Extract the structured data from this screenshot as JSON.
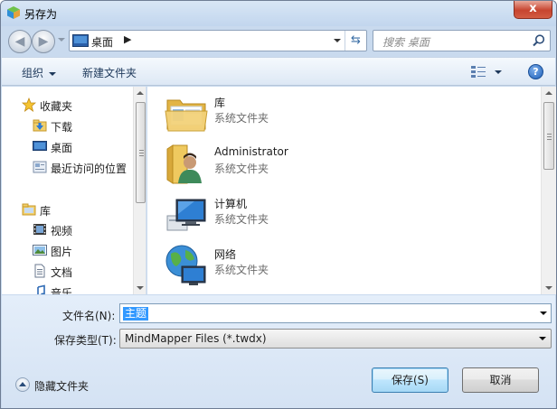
{
  "window": {
    "title": "另存为",
    "close_label": "x"
  },
  "address": {
    "location": "桌面",
    "search_placeholder": "搜索 桌面"
  },
  "toolbar": {
    "organize_label": "组织",
    "new_folder_label": "新建文件夹",
    "help_label": "?"
  },
  "nav_pane": {
    "items": [
      {
        "label": "收藏夹",
        "icon": "star-icon"
      },
      {
        "label": "下载",
        "icon": "download-folder-icon"
      },
      {
        "label": "桌面",
        "icon": "desktop-icon"
      },
      {
        "label": "最近访问的位置",
        "icon": "recent-places-icon"
      },
      {
        "label": "库",
        "icon": "library-icon"
      },
      {
        "label": "视频",
        "icon": "video-icon"
      },
      {
        "label": "图片",
        "icon": "picture-icon"
      },
      {
        "label": "文档",
        "icon": "document-icon"
      },
      {
        "label": "音乐",
        "icon": "music-icon"
      }
    ]
  },
  "files": [
    {
      "name": "库",
      "type": "系统文件夹",
      "icon": "library-folder-icon"
    },
    {
      "name": "Administrator",
      "type": "系统文件夹",
      "icon": "user-folder-icon"
    },
    {
      "name": "计算机",
      "type": "系统文件夹",
      "icon": "computer-icon"
    },
    {
      "name": "网络",
      "type": "系统文件夹",
      "icon": "network-icon"
    }
  ],
  "form": {
    "filename_label": "文件名(N):",
    "filename_value": "主题",
    "filetype_label": "保存类型(T):",
    "filetype_value": "MindMapper Files (*.twdx)"
  },
  "footer": {
    "hide_folders_label": "隐藏文件夹",
    "save_label": "保存(S)",
    "cancel_label": "取消"
  },
  "colors": {
    "accent": "#3399ff",
    "window_frame": "#c9daee",
    "close_red": "#c7442f"
  }
}
